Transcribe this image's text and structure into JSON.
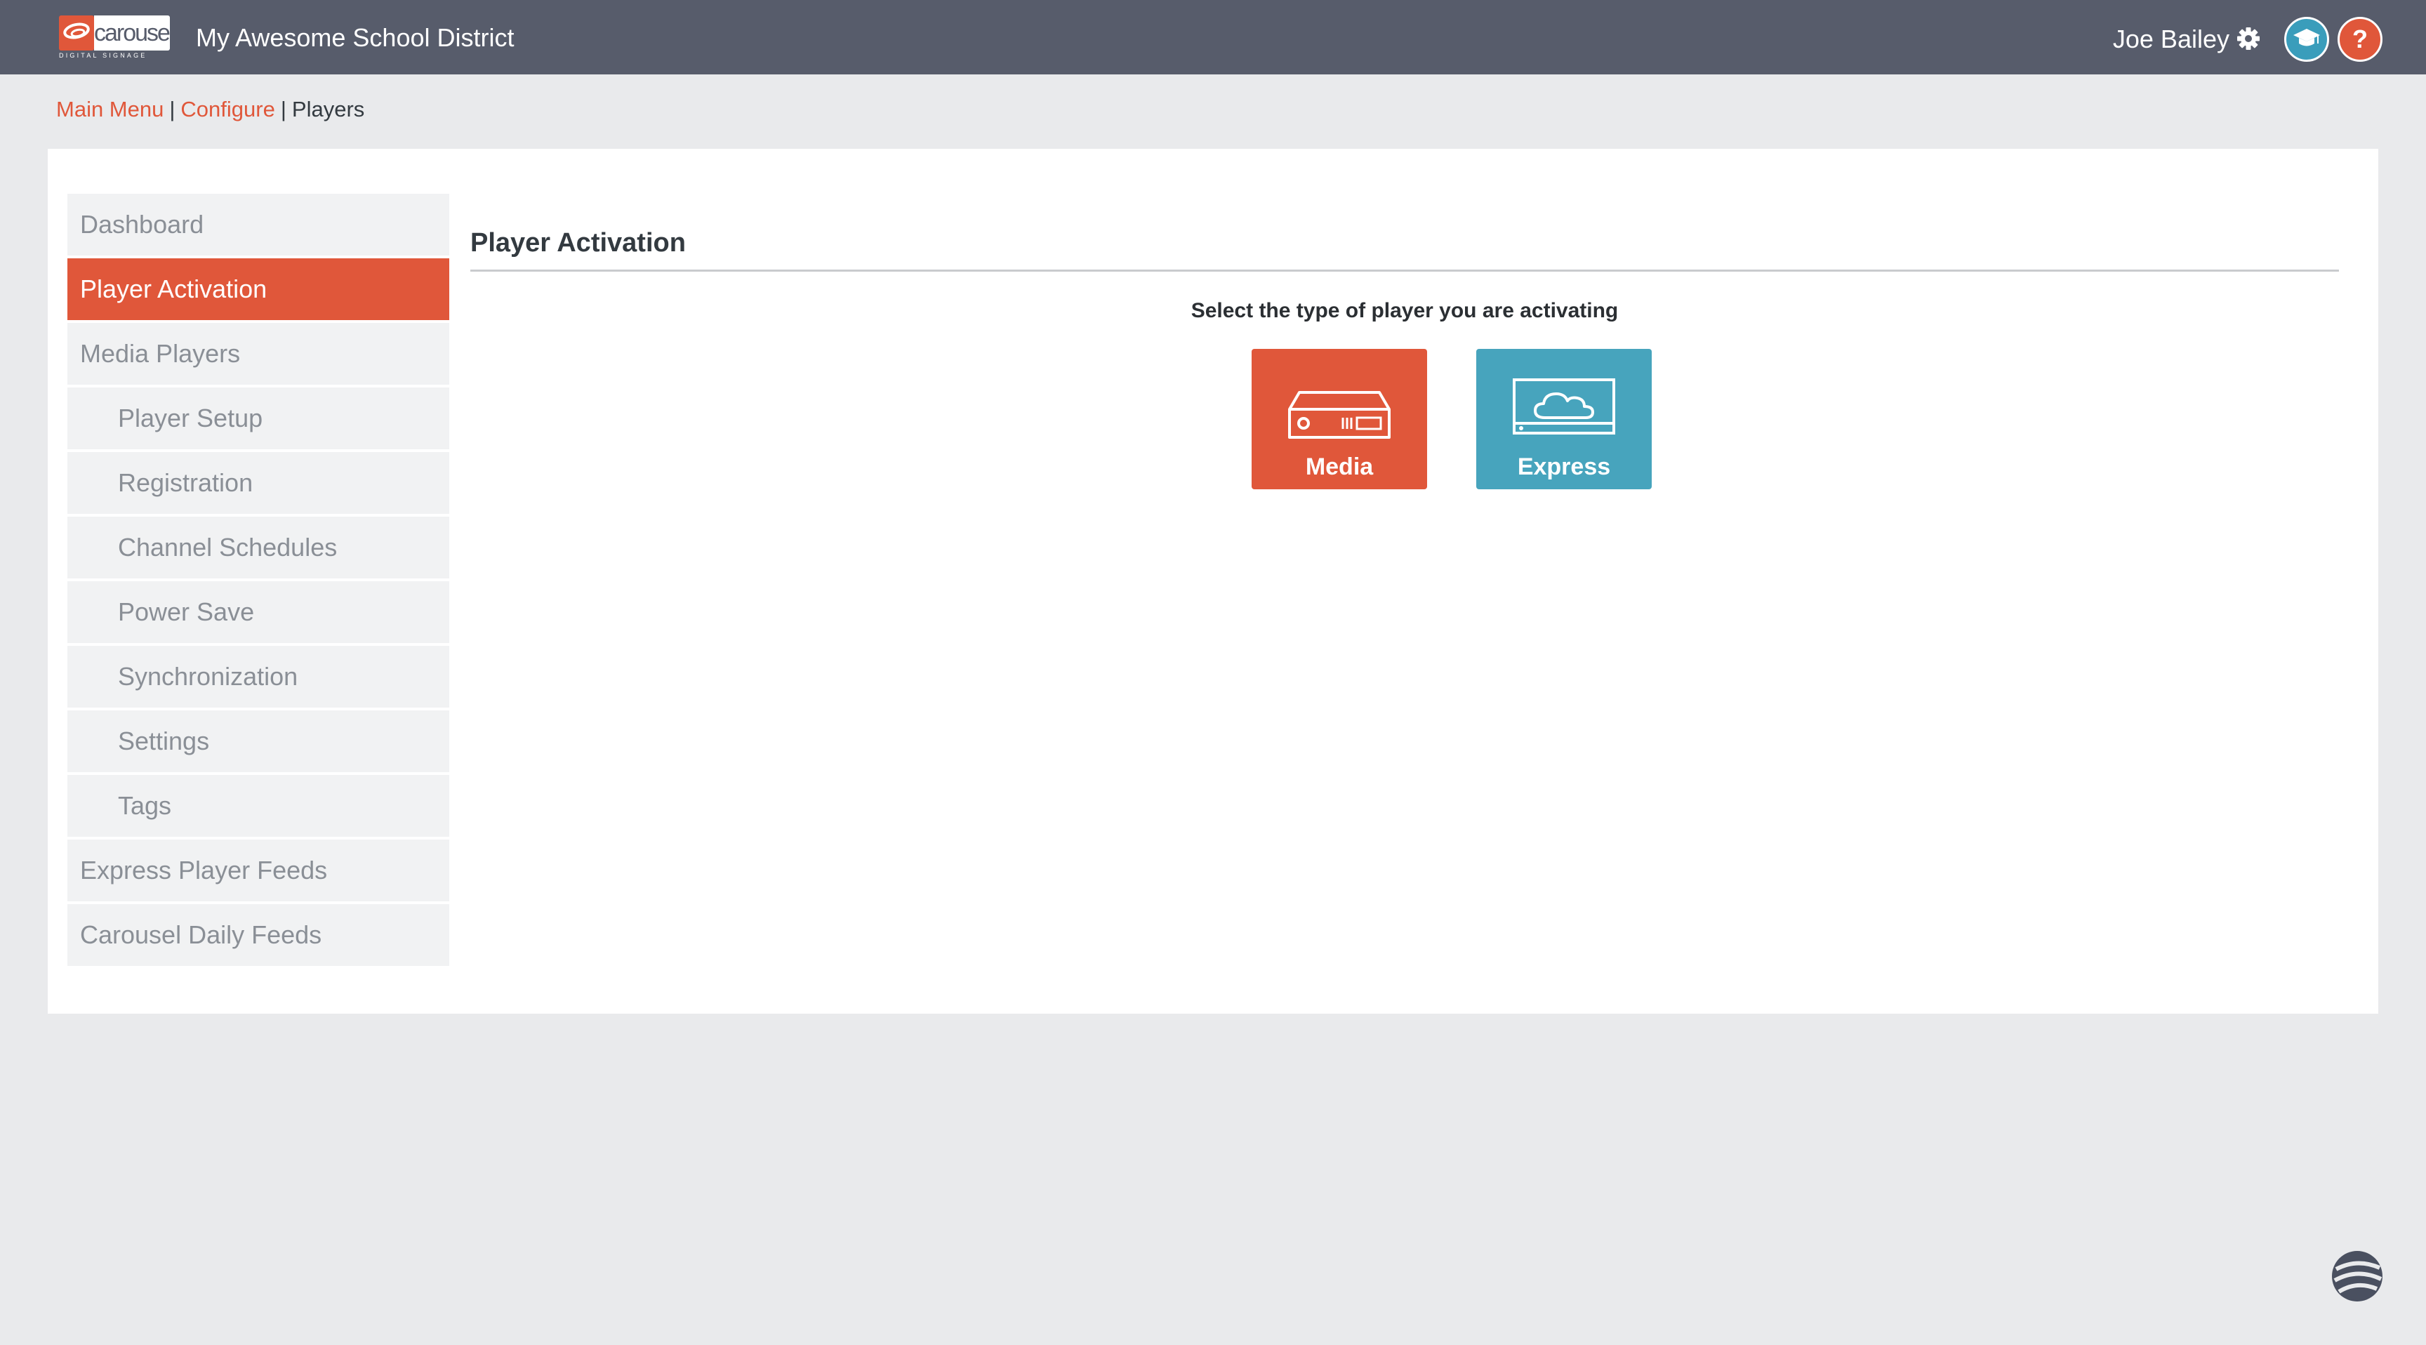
{
  "header": {
    "logo_word": "carousel",
    "logo_tagline": "DIGITAL SIGNAGE",
    "org_title": "My Awesome School District",
    "user_name": "Joe Bailey",
    "settings_icon": "gear-icon",
    "academy_icon": "graduation-cap-icon",
    "help_label": "?"
  },
  "breadcrumb": {
    "items": [
      "Main Menu",
      "Configure",
      "Players"
    ],
    "separator": "|"
  },
  "sidebar": {
    "items": [
      {
        "label": "Dashboard",
        "level": 0
      },
      {
        "label": "Player Activation",
        "level": 0,
        "active": true
      },
      {
        "label": "Media Players",
        "level": 0
      },
      {
        "label": "Player Setup",
        "level": 1
      },
      {
        "label": "Registration",
        "level": 1
      },
      {
        "label": "Channel Schedules",
        "level": 1
      },
      {
        "label": "Power Save",
        "level": 1
      },
      {
        "label": "Synchronization",
        "level": 1
      },
      {
        "label": "Settings",
        "level": 1
      },
      {
        "label": "Tags",
        "level": 1
      },
      {
        "label": "Express Player Feeds",
        "level": 0
      },
      {
        "label": "Carousel Daily Feeds",
        "level": 0
      }
    ]
  },
  "main": {
    "title": "Player Activation",
    "prompt": "Select the type of player you are activating",
    "choices": [
      {
        "label": "Media",
        "icon": "media-player-device-icon",
        "color": "#e0573a"
      },
      {
        "label": "Express",
        "icon": "cloud-display-icon",
        "color": "#47a4bd"
      }
    ]
  },
  "colors": {
    "accent": "#e0573a",
    "topbar": "#575c6b",
    "express": "#47a4bd"
  }
}
